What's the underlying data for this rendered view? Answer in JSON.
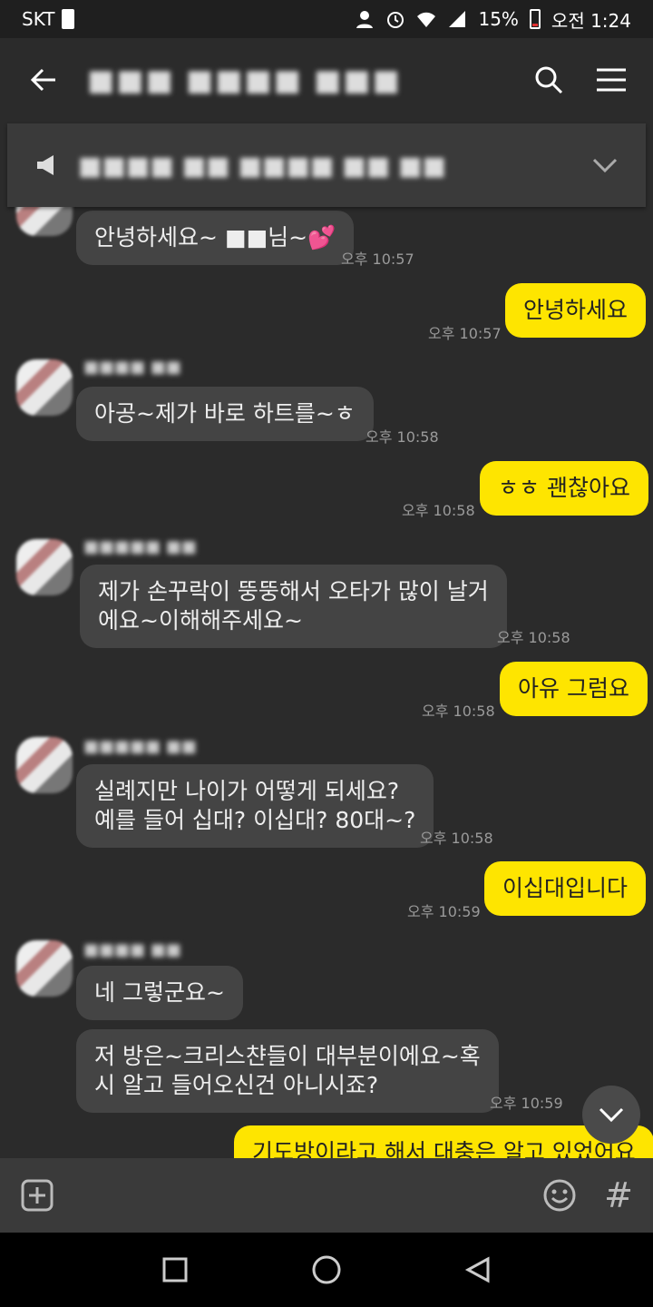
{
  "status_bar": {
    "carrier": "SKT",
    "battery": "15%",
    "time": "오전 1:24",
    "battery_level": 0.15
  },
  "header": {
    "title": "■■■ ■■■■ ■■■"
  },
  "notice": {
    "text": "■■■■ ■■ ■■■■ ■■ ■■"
  },
  "messages": [
    {
      "dir": "in",
      "text": "안녕하세요~ ■■님~",
      "emoji": "💕",
      "time": "오후 10:57"
    },
    {
      "dir": "out",
      "text": "안녕하세요",
      "time": "오후 10:57"
    },
    {
      "dir": "in",
      "sender": "■■■■ ■■",
      "text": "아공~제가 바로 하트를~ㅎ",
      "time": "오후 10:58"
    },
    {
      "dir": "out",
      "text": "ㅎㅎ 괜찮아요",
      "time": "오후 10:58"
    },
    {
      "dir": "in",
      "sender": "■■■■■ ■■",
      "line1": "제가 손꾸락이 뚱뚱해서 오타가 많이 날거",
      "line2": "에요~이해해주세요~",
      "time": "오후 10:58"
    },
    {
      "dir": "out",
      "text": "아유 그럼요",
      "time": "오후 10:58"
    },
    {
      "dir": "in",
      "sender": "■■■■■ ■■",
      "line1": "실례지만 나이가 어떻게 되세요?",
      "line2": "예를 들어 십대? 이십대? 80대~?",
      "time": "오후 10:58"
    },
    {
      "dir": "out",
      "text": "이십대입니다",
      "time": "오후 10:59"
    },
    {
      "dir": "in",
      "sender": "■■■■ ■■",
      "text": "네 그렇군요~"
    },
    {
      "dir": "in",
      "line1": "저 방은~크리스챤들이 대부분이에요~혹",
      "line2": "시 알고 들어오신건 아니시죠?",
      "time": "오후 10:59"
    },
    {
      "dir": "out",
      "text": "기도방이라고 해서 대충은 알고 있었어요"
    }
  ],
  "icons": {
    "back": "arrow-left-icon",
    "search": "search-icon",
    "menu": "hamburger-menu-icon",
    "notice": "megaphone-icon",
    "expand": "chevron-down-icon",
    "add": "plus-square-icon",
    "emoji": "smiley-icon",
    "hash": "hash-icon"
  },
  "bottom": {
    "hash": "#"
  },
  "colors": {
    "sent_bubble": "#fee500",
    "recv_bubble": "#444444",
    "background": "#2b2b2b"
  }
}
